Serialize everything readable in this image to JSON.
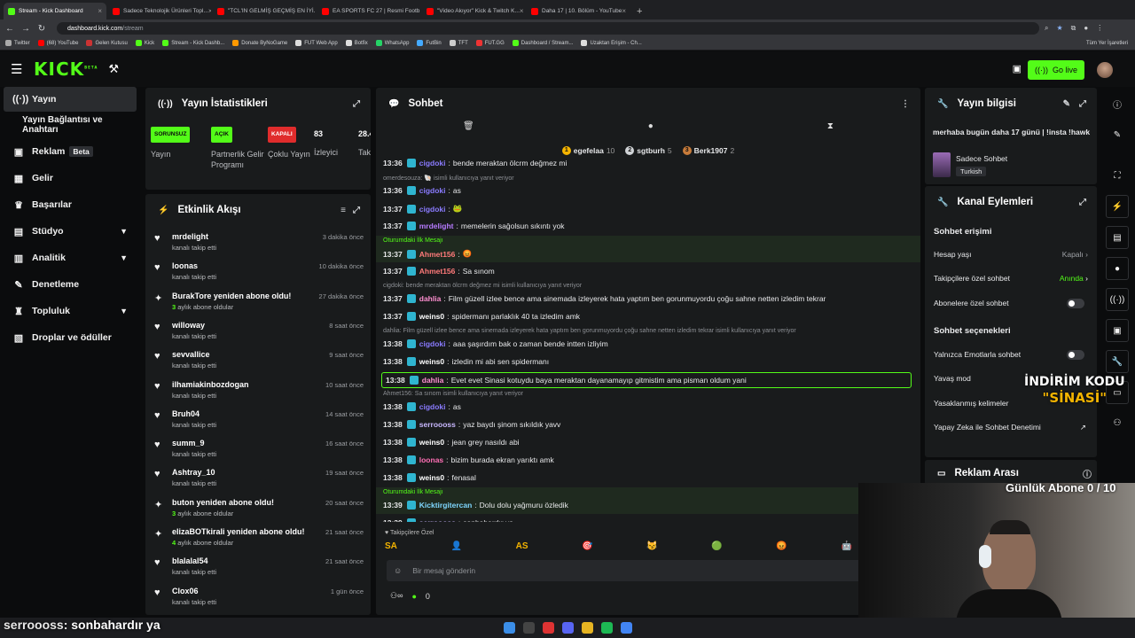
{
  "browser": {
    "tabs": [
      {
        "label": "Stream - Kick Dashboard",
        "active": true,
        "color": "#53fc18"
      },
      {
        "label": "Sadece Teknolojik Ürünleri Topl...",
        "active": false,
        "color": "#ff0000"
      },
      {
        "label": "\"TCL'IN GELMİŞ GEÇMİŞ EN İYİ...",
        "active": false,
        "color": "#ff0000"
      },
      {
        "label": "EA SPORTS FC 27 | Resmi Footb...",
        "active": false,
        "color": "#ff0000"
      },
      {
        "label": "\"Video Akıyor\" Kick & Twitch K...",
        "active": false,
        "color": "#ff0000"
      },
      {
        "label": "Daha 17 | 10. Bölüm - YouTube",
        "active": false,
        "color": "#ff0000"
      }
    ],
    "url_host": "dashboard.kick.com",
    "url_path": "/stream",
    "bookmarks": [
      "Twitter",
      "(68) YouTube",
      "Gelen Kutusu",
      "Kick",
      "Stream - Kick Dashb...",
      "Donate ByNoGame",
      "FUT Web App",
      "Botfix",
      "WhatsApp",
      "FutBin",
      "TFT",
      "FUT.GG",
      "Dashboard / Stream...",
      "Uzaktan Erişim - Ch..."
    ],
    "bookmarks_right": "Tüm Yer İşaretleri"
  },
  "topbar": {
    "logo": "KICK",
    "logo_sup": "BETA",
    "go_live": "Go live"
  },
  "sidebar": {
    "items": [
      {
        "label": "Yayın",
        "icon": "broadcast-icon",
        "glyph": "((·))"
      },
      {
        "label": "Yayın Bağlantısı ve Anahtarı",
        "icon": "",
        "glyph": ""
      },
      {
        "label": "Reklam",
        "icon": "ad-icon",
        "glyph": "▣",
        "badge": "Beta"
      },
      {
        "label": "Gelir",
        "icon": "revenue-icon",
        "glyph": "▦"
      },
      {
        "label": "Başarılar",
        "icon": "trophy-icon",
        "glyph": "♛"
      },
      {
        "label": "Stüdyo",
        "icon": "studio-icon",
        "glyph": "▤",
        "chevron": true
      },
      {
        "label": "Analitik",
        "icon": "analytics-icon",
        "glyph": "▥",
        "chevron": true
      },
      {
        "label": "Denetleme",
        "icon": "moderation-icon",
        "glyph": "✎"
      },
      {
        "label": "Topluluk",
        "icon": "community-icon",
        "glyph": "♜",
        "chevron": true
      },
      {
        "label": "Droplar ve ödüller",
        "icon": "drops-icon",
        "glyph": "▧"
      }
    ]
  },
  "stats": {
    "title": "Yayın İstatistikleri",
    "items": [
      {
        "badge": "SORUNSUZ",
        "badge_color": "green",
        "label": "Yayın"
      },
      {
        "badge": "AÇIK",
        "badge_color": "green",
        "label": "Partnerlik Gelir Programı"
      },
      {
        "badge": "KAPALI",
        "badge_color": "red",
        "label": "Çoklu Yayın"
      },
      {
        "value": "83",
        "label": "İzleyici"
      },
      {
        "value": "28.4",
        "label": "Takip"
      }
    ]
  },
  "activity": {
    "title": "Etkinlik Akışı",
    "items": [
      {
        "name": "mrdelight",
        "sub": "kanalı takip etti",
        "time": "3 dakika önce",
        "kind": "follow"
      },
      {
        "name": "loonas",
        "sub": "kanalı takip etti",
        "time": "10 dakika önce",
        "kind": "follow"
      },
      {
        "name": "BurakTore yeniden abone oldu!",
        "sub_bold": "3",
        "sub": " aylık abone oldular",
        "time": "27 dakika önce",
        "kind": "sub"
      },
      {
        "name": "willoway",
        "sub": "kanalı takip etti",
        "time": "8 saat önce",
        "kind": "follow"
      },
      {
        "name": "sevvallice",
        "sub": "kanalı takip etti",
        "time": "9 saat önce",
        "kind": "follow"
      },
      {
        "name": "ilhamiakinbozdogan",
        "sub": "kanalı takip etti",
        "time": "10 saat önce",
        "kind": "follow"
      },
      {
        "name": "Bruh04",
        "sub": "kanalı takip etti",
        "time": "14 saat önce",
        "kind": "follow"
      },
      {
        "name": "summ_9",
        "sub": "kanalı takip etti",
        "time": "16 saat önce",
        "kind": "follow"
      },
      {
        "name": "Ashtray_10",
        "sub": "kanalı takip etti",
        "time": "19 saat önce",
        "kind": "follow"
      },
      {
        "name": "buton yeniden abone oldu!",
        "sub_bold": "3",
        "sub": " aylık abone oldular",
        "time": "20 saat önce",
        "kind": "sub"
      },
      {
        "name": "elizaBOTkirali yeniden abone oldu!",
        "sub_bold": "4",
        "sub": " aylık abone oldular",
        "time": "21 saat önce",
        "kind": "sub"
      },
      {
        "name": "blalalal54",
        "sub": "kanalı takip etti",
        "time": "21 saat önce",
        "kind": "follow"
      },
      {
        "name": "Clox06",
        "sub": "kanalı takip etti",
        "time": "1 gün önce",
        "kind": "follow"
      }
    ]
  },
  "chat": {
    "title": "Sohbet",
    "top_gifters": [
      {
        "rank": "1",
        "name": "egefelaa",
        "count": "10",
        "color": "#f5b400"
      },
      {
        "rank": "2",
        "name": "sgtburh",
        "count": "5",
        "color": "#d0d3d6"
      },
      {
        "rank": "3",
        "name": "Berk1907",
        "count": "2",
        "color": "#c77b3a"
      }
    ],
    "first_label": "Oturumdaki İlk Mesajı",
    "messages": [
      {
        "type": "msg",
        "time": "13:36",
        "user": "cigdoki",
        "ucolor": "#8a7bff",
        "text": "bende meraktan ölcrm değmez mi",
        "partial": true
      },
      {
        "type": "reply",
        "text": "omerdesouza: 🐚 isimli kullanıcıya yanıt veriyor"
      },
      {
        "type": "msg",
        "time": "13:36",
        "user": "cigdoki",
        "ucolor": "#8a7bff",
        "text": "as"
      },
      {
        "type": "msg",
        "time": "13:37",
        "user": "cigdoki",
        "ucolor": "#8a7bff",
        "text": "🐸"
      },
      {
        "type": "msg",
        "time": "13:37",
        "user": "mrdelight",
        "ucolor": "#b67bff",
        "text": "memelerin sağolsun sıkıntı yok"
      },
      {
        "type": "msg",
        "time": "13:37",
        "user": "Ahmet156",
        "ucolor": "#ff7a7a",
        "text": "😡",
        "first": true
      },
      {
        "type": "msg",
        "time": "13:37",
        "user": "Ahmet156",
        "ucolor": "#ff7a7a",
        "text": "Sa sınom"
      },
      {
        "type": "reply",
        "text": "cigdoki: bende meraktan ölcrm değmez mi isimli kullanıcıya yanıt veriyor"
      },
      {
        "type": "msg",
        "time": "13:37",
        "user": "dahlia",
        "ucolor": "#ff8fd0",
        "text": "Film güzell izlee bence ama sinemada izleyerek hata yaptım ben gorunmuyordu çoğu sahne netten izledim tekrar"
      },
      {
        "type": "msg",
        "time": "13:37",
        "user": "weins0",
        "ucolor": "#ffffff",
        "text": "spidermanı parlaklık 40 ta izledim amk"
      },
      {
        "type": "reply",
        "text": "dahlia: Film güzell izlee bence ama sinemada izleyerek hata yaptım ben gorunmuyordu çoğu sahne netten izledim tekrar isimli kullanıcıya yanıt veriyor"
      },
      {
        "type": "msg",
        "time": "13:38",
        "user": "cigdoki",
        "ucolor": "#8a7bff",
        "text": "aaa şaşırdım bak o zaman bende intten izliyim"
      },
      {
        "type": "msg",
        "time": "13:38",
        "user": "weins0",
        "ucolor": "#ffffff",
        "text": "izledin mi abi sen spidermanı"
      },
      {
        "type": "msg",
        "time": "13:38",
        "user": "dahlia",
        "ucolor": "#ff8fd0",
        "text": "Evet evet Sinasi kotuydu baya meraktan dayanamayıp gitmistim ama pisman oldum yani",
        "highlight": true
      },
      {
        "type": "reply",
        "text": "Ahmet156: Sa sınom isimli kullanıcıya yanıt veriyor"
      },
      {
        "type": "msg",
        "time": "13:38",
        "user": "cigdoki",
        "ucolor": "#8a7bff",
        "text": "as"
      },
      {
        "type": "msg",
        "time": "13:38",
        "user": "serroooss",
        "ucolor": "#c9b8ff",
        "text": "yaz baydı şinom sıkıldık yavv"
      },
      {
        "type": "msg",
        "time": "13:38",
        "user": "weins0",
        "ucolor": "#ffffff",
        "text": "jean grey nasıldı abi"
      },
      {
        "type": "msg",
        "time": "13:38",
        "user": "loonas",
        "ucolor": "#ff6fb5",
        "text": "bizim burada ekran yarıktı amk"
      },
      {
        "type": "msg",
        "time": "13:38",
        "user": "weins0",
        "ucolor": "#ffffff",
        "text": "fenasal"
      },
      {
        "type": "msg",
        "time": "13:39",
        "user": "Kicktirgitercan",
        "ucolor": "#7fd7ff",
        "text": "Dolu dolu yağmuru özledik",
        "first": true
      },
      {
        "type": "msg",
        "time": "13:39",
        "user": "serroooss",
        "ucolor": "#c9b8ff",
        "text": "sonbahardır ya"
      }
    ],
    "emote_label": "Takipçilere Özel",
    "emotes": [
      "SA",
      "👤",
      "AS",
      "🎯",
      "😼",
      "🟢",
      "😡",
      "🤖",
      "🟩"
    ],
    "input_placeholder": "Bir mesaj gönderin",
    "footer_count": "0"
  },
  "stream_info": {
    "title": "Yayın bilgisi",
    "stream_title": "merhaba bugün daha 17 günü | !insta !hawk",
    "category": "Sadece Sohbet",
    "language": "Turkish"
  },
  "channel_actions": {
    "title": "Kanal Eylemleri",
    "chat_access": "Sohbet erişimi",
    "slow_mode": {
      "label": "Hesap yaşı",
      "value": "Kapalı"
    },
    "followers": {
      "label": "Takipçilere özel sohbet",
      "value": "Anında"
    },
    "subs": {
      "label": "Abonelere özel sohbet"
    },
    "chat_options": "Sohbet seçenekleri",
    "emote_only": "Yalnızca Emotlarla sohbet",
    "slow": "Yavaş mod",
    "banned_words": "Yasaklanmış kelimeler",
    "ai_mod": "Yapay Zeka ile Sohbet Denetimi"
  },
  "ad_break": {
    "title": "Reklam Arası"
  },
  "overlay": {
    "promo_line1": "İNDİRİM KODU",
    "promo_line2": "\"SİNASİ\"",
    "sub_goal": "Günlük Abone 0 / 10",
    "chat_user": "serroooss",
    "chat_text": ": sonbahardır ya"
  },
  "colors": {
    "accent": "#53fc18",
    "panel": "#191b1c",
    "bg": "#0b0c0d"
  }
}
